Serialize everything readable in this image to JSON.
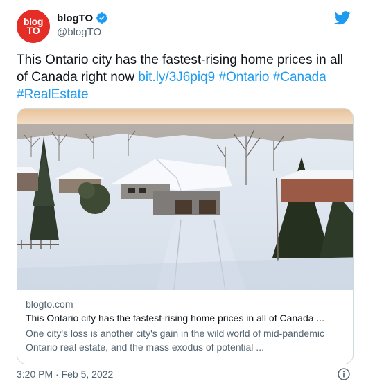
{
  "author": {
    "display_name": "blogTO",
    "handle": "@blogTO",
    "avatar_line1": "blog",
    "avatar_line2": "TO",
    "verified": true,
    "avatar_color": "#e42d27"
  },
  "tweet": {
    "text": "This Ontario city has the fastest-rising home prices in all of Canada right now ",
    "link": "bit.ly/3J6piq9",
    "hashtags": [
      "#Ontario",
      "#Canada",
      "#RealEstate"
    ],
    "timestamp": "3:20 PM · Feb 5, 2022"
  },
  "card": {
    "domain": "blogto.com",
    "title": "This Ontario city has the fastest-rising home prices in all of Canada ...",
    "description": "One city's loss is another city's gain in the wild world of mid-pandemic Ontario real estate, and the mass exodus of potential ..."
  },
  "icons": {
    "twitter": "twitter-bird-icon",
    "verified": "verified-badge-icon",
    "info": "info-icon"
  },
  "colors": {
    "link": "#1d9bf0",
    "secondary_text": "#536471",
    "brand_twitter": "#1d9bf0"
  }
}
